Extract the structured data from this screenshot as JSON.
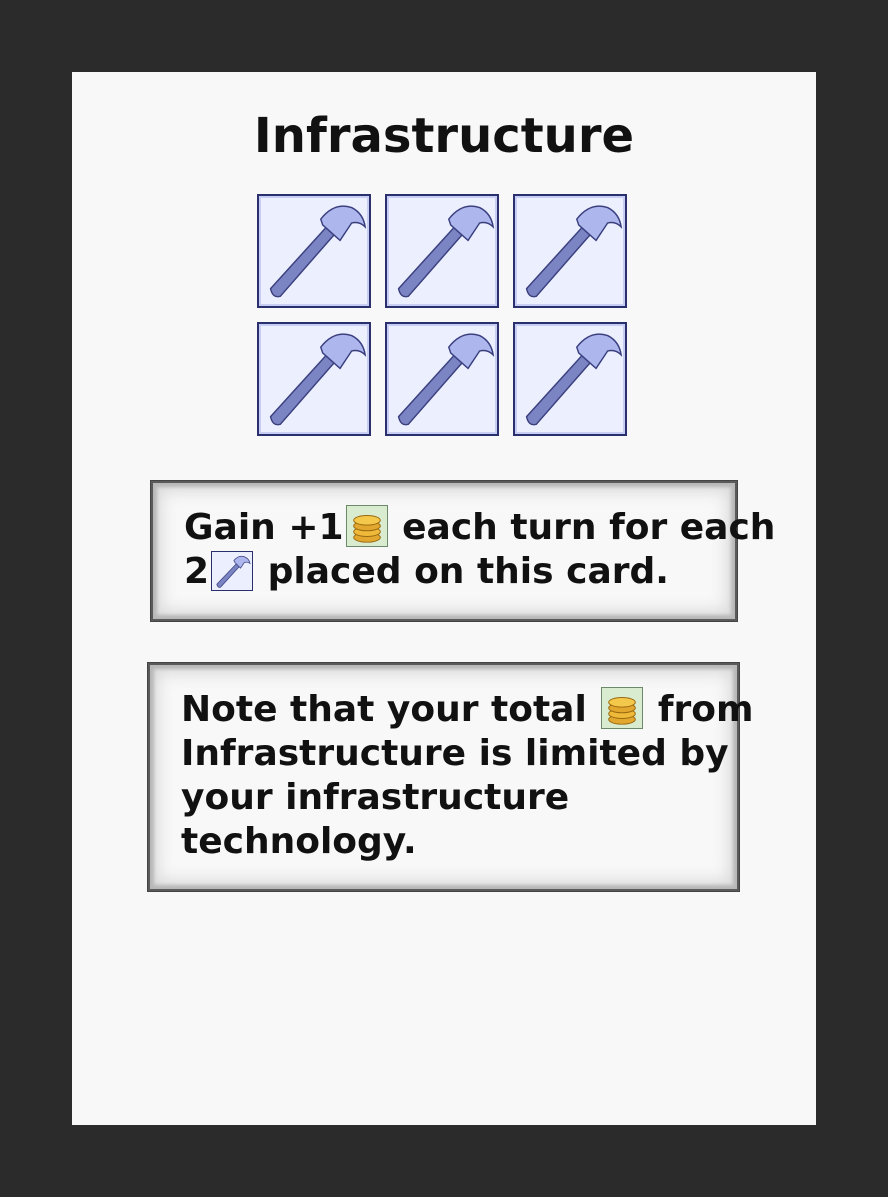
{
  "card": {
    "title": "Infrastructure",
    "slots": {
      "count": 6,
      "icon": "hammer-icon",
      "colors": {
        "slot_fill": "#eceffe",
        "slot_border": "#2a2f6e",
        "hammer_fill": "#7b85c4",
        "hammer_head": "#aeb6ee"
      }
    },
    "ability": {
      "text_gain": "Gain +1",
      "coin_icon": "coin-icon",
      "text_each_turn": "each turn for each",
      "text_count": "2",
      "hammer_icon": "hammer-icon",
      "text_placed": "placed on this card."
    },
    "note": {
      "text_note": "Note that your total",
      "coin_icon": "coin-icon",
      "text_from": "from",
      "line2": "Infrastructure is limited by",
      "line3": "your infrastructure",
      "line4": "technology."
    }
  }
}
